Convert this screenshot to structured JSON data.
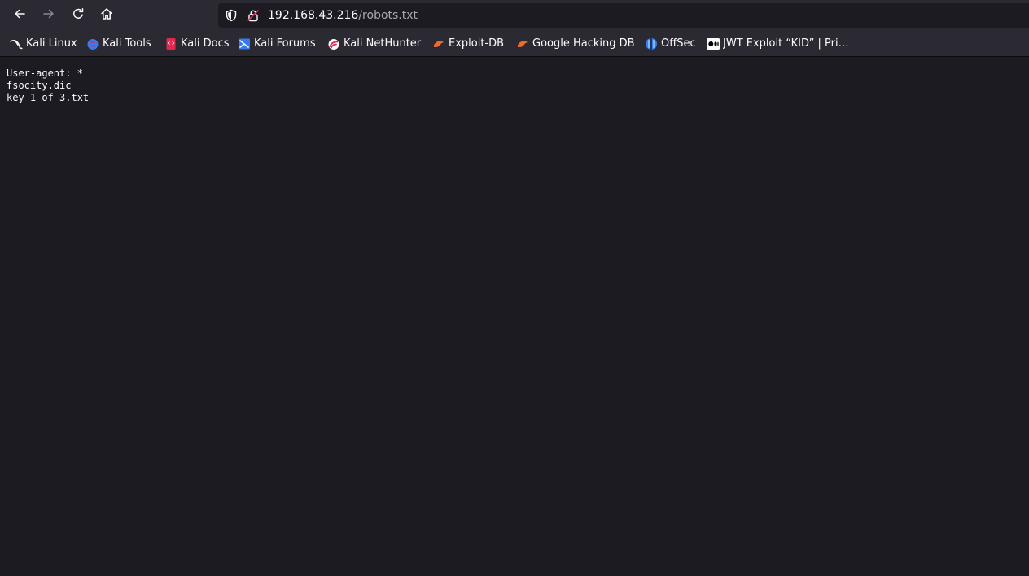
{
  "toolbar": {
    "back_icon": "arrow-left-icon",
    "forward_icon": "arrow-right-icon",
    "reload_icon": "reload-icon",
    "home_icon": "home-icon"
  },
  "urlbar": {
    "host": "192.168.43.216",
    "path": "/robots.txt",
    "tracking_icon": "shield-icon",
    "security_icon": "insecure-lock-icon"
  },
  "bookmarks": [
    {
      "label": "Kali Linux",
      "icon": "kali-dragon-icon"
    },
    {
      "label": "Kali Tools",
      "icon": "kali-tools-icon"
    },
    {
      "label": "Kali Docs",
      "icon": "kali-docs-icon"
    },
    {
      "label": "Kali Forums",
      "icon": "kali-forums-icon"
    },
    {
      "label": "Kali NetHunter",
      "icon": "nethunter-icon"
    },
    {
      "label": "Exploit-DB",
      "icon": "exploit-db-icon"
    },
    {
      "label": "Google Hacking DB",
      "icon": "ghdb-icon"
    },
    {
      "label": "OffSec",
      "icon": "offsec-icon"
    },
    {
      "label": "JWT Exploit “KID” | Pri…",
      "icon": "medium-icon"
    }
  ],
  "content": {
    "lines": [
      "User-agent: *",
      "fsocity.dic",
      "key-1-of-3.txt"
    ]
  },
  "colors": {
    "toolbar_bg": "#2b2a33",
    "page_bg": "#1c1b22",
    "text": "#fbfbfe",
    "url_path": "#a8a8ae",
    "insecure_strike": "#e22850"
  }
}
